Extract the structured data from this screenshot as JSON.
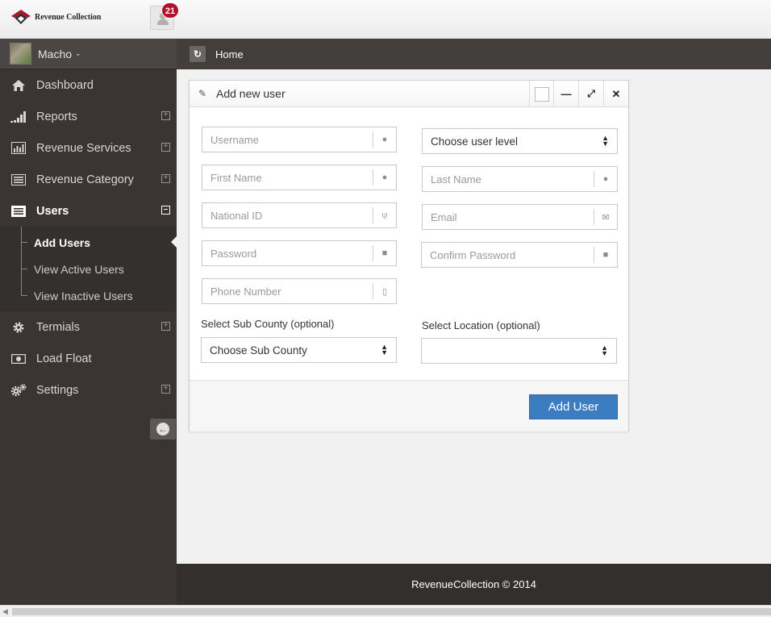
{
  "app": {
    "logo_text": "Revenue Collection",
    "notifications_count": "21"
  },
  "sidebar": {
    "user_name": "Macho",
    "items": [
      {
        "label": "Dashboard",
        "icon": "home-icon"
      },
      {
        "label": "Reports",
        "icon": "bar-signal-icon"
      },
      {
        "label": "Revenue Services",
        "icon": "bar-chart-icon"
      },
      {
        "label": "Revenue Category",
        "icon": "list-icon"
      },
      {
        "label": "Users",
        "icon": "list-icon"
      },
      {
        "label": "Termials",
        "icon": "gear-icon"
      },
      {
        "label": "Load Float",
        "icon": "money-icon"
      },
      {
        "label": "Settings",
        "icon": "gears-icon"
      }
    ],
    "users_submenu": [
      "Add Users",
      "View Active Users",
      "View Inactive Users"
    ]
  },
  "breadcrumb": {
    "home": "Home"
  },
  "panel": {
    "title": "Add new user",
    "fields": {
      "username": "Username",
      "first_name": "First Name",
      "national_id": "National ID",
      "password": "Password",
      "phone_number": "Phone Number",
      "last_name": "Last Name",
      "email": "Email",
      "confirm_password": "Confirm Password"
    },
    "user_level_select": "Choose user level",
    "sub_county_label": "Select Sub County (optional)",
    "sub_county_select": "Choose Sub County",
    "location_label": "Select Location (optional)",
    "location_select": "",
    "submit_label": "Add User"
  },
  "footer": {
    "text": "RevenueCollection © 2014"
  },
  "colors": {
    "sidebar_bg": "#3a3532",
    "primary_button": "#3c7dc2",
    "badge": "#b3112b"
  }
}
